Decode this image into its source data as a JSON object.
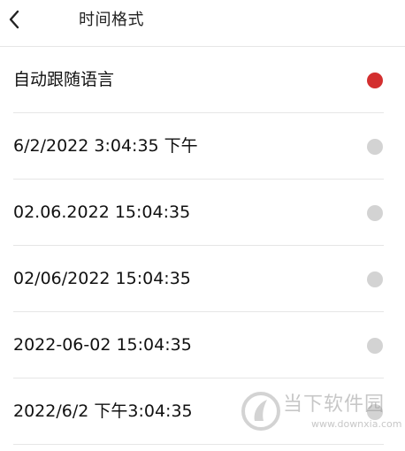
{
  "header": {
    "title": "时间格式",
    "back_icon": "chevron-left-icon"
  },
  "options": [
    {
      "label": "自动跟随语言",
      "selected": true
    },
    {
      "label": "6/2/2022 3:04:35 下午",
      "selected": false
    },
    {
      "label": "02.06.2022 15:04:35",
      "selected": false
    },
    {
      "label": "02/06/2022 15:04:35",
      "selected": false
    },
    {
      "label": "2022-06-02 15:04:35",
      "selected": false
    },
    {
      "label": "2022/6/2 下午3:04:35",
      "selected": false
    }
  ],
  "colors": {
    "selected": "#d32f2f",
    "unselected": "#d3d3d3",
    "divider": "#e6e6e6"
  },
  "watermark": {
    "text": "当下软件园",
    "url": "www.downxia.com"
  }
}
